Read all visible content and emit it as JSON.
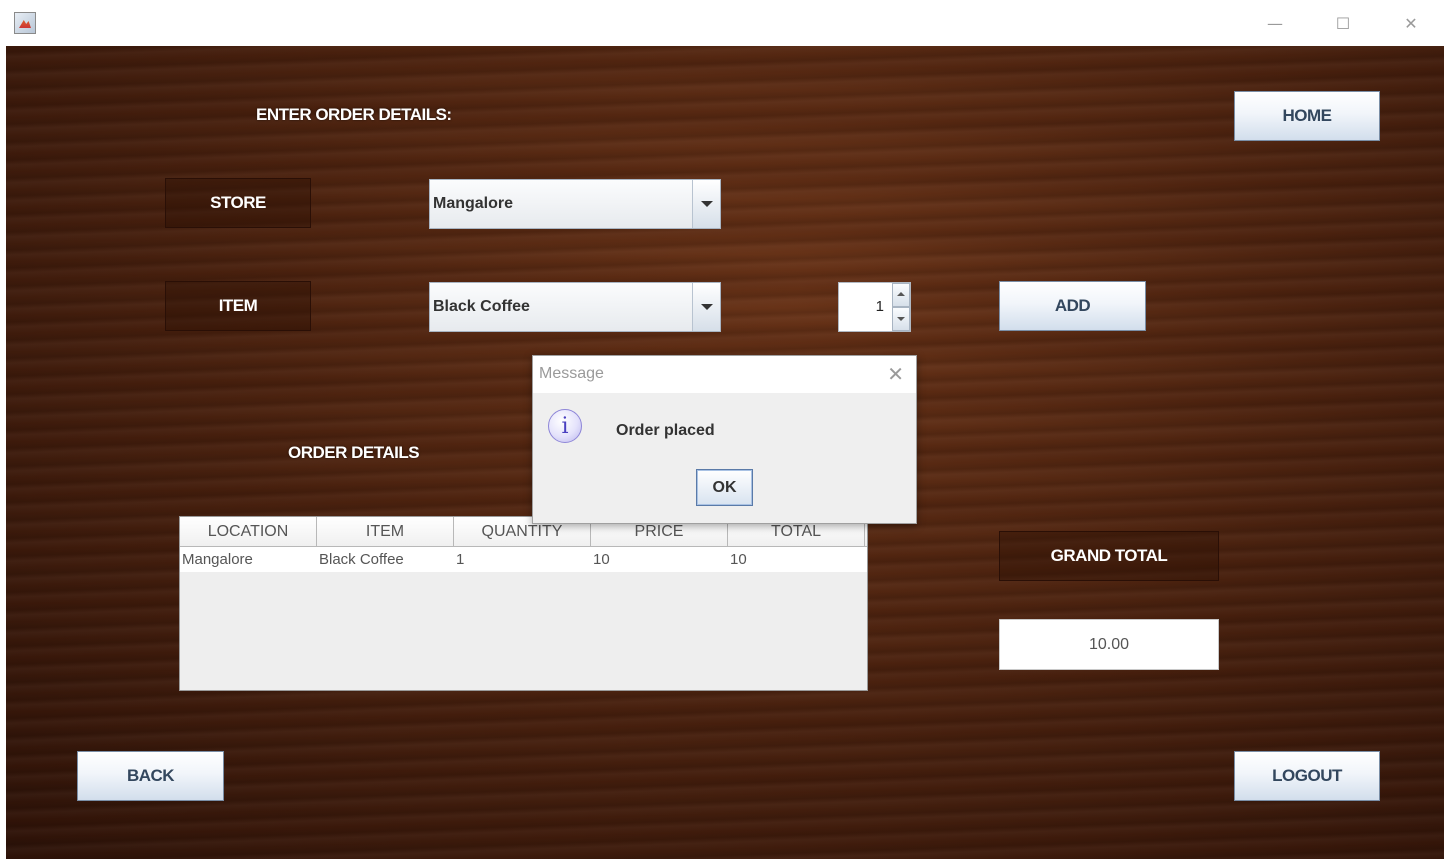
{
  "window": {
    "minimize_glyph": "—",
    "maximize_glyph": "☐",
    "close_glyph": "✕"
  },
  "form": {
    "heading": "ENTER ORDER DETAILS:",
    "home_label": "HOME",
    "store_label": "STORE",
    "store_value": "Mangalore",
    "item_label": "ITEM",
    "item_value": "Black Coffee",
    "quantity_value": "1",
    "add_label": "ADD"
  },
  "order": {
    "heading": "ORDER DETAILS",
    "columns": [
      "LOCATION",
      "ITEM",
      "QUANTITY",
      "PRICE",
      "TOTAL"
    ],
    "rows": [
      [
        "Mangalore",
        "Black Coffee",
        "1",
        "10",
        "10"
      ]
    ],
    "grand_total_label": "GRAND TOTAL",
    "grand_total_value": "10.00"
  },
  "footer": {
    "back_label": "BACK",
    "logout_label": "LOGOUT"
  },
  "dialog": {
    "title": "Message",
    "message": "Order placed",
    "ok_label": "OK",
    "icon_glyph": "i",
    "close_glyph": "✕"
  },
  "icons": {
    "app": "java-app-icon",
    "info": "info-icon",
    "dropdown": "chevron-down-icon"
  },
  "colors": {
    "wood_dark": "#2c1208",
    "wood_mid": "#5a2a12",
    "button_gradient_bottom": "#d2deec",
    "button_text": "#33475e"
  }
}
